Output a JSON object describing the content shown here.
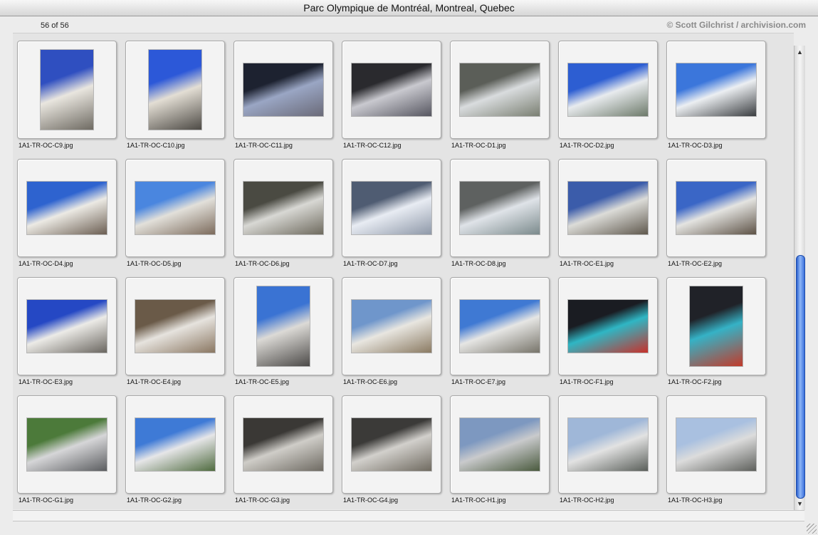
{
  "window": {
    "title": "Parc Olympique de Montréal, Montreal, Quebec",
    "counter": "56 of 56",
    "copyright": "© Scott Gilchrist / archivision.com"
  },
  "thumbnails": [
    {
      "filename": "1A1-TR-OC-C9.jpg",
      "orientation": "portrait",
      "colors": [
        "#2f4fc0",
        "#e9e6df",
        "#6e6a62"
      ]
    },
    {
      "filename": "1A1-TR-OC-C10.jpg",
      "orientation": "portrait",
      "colors": [
        "#2c58d8",
        "#e3ded4",
        "#4d4a45"
      ]
    },
    {
      "filename": "1A1-TR-OC-C11.jpg",
      "orientation": "landscape",
      "colors": [
        "#1d2230",
        "#9aa6c4",
        "#6a6a78"
      ]
    },
    {
      "filename": "1A1-TR-OC-C12.jpg",
      "orientation": "landscape",
      "colors": [
        "#2a2a2e",
        "#c9c9cf",
        "#565660"
      ]
    },
    {
      "filename": "1A1-TR-OC-D1.jpg",
      "orientation": "landscape",
      "colors": [
        "#5b5e58",
        "#d9dcde",
        "#7a7f72"
      ]
    },
    {
      "filename": "1A1-TR-OC-D2.jpg",
      "orientation": "landscape",
      "colors": [
        "#2d5ed2",
        "#e8ebee",
        "#6d7a6a"
      ]
    },
    {
      "filename": "1A1-TR-OC-D3.jpg",
      "orientation": "landscape",
      "colors": [
        "#3b76db",
        "#eceff2",
        "#3a3d40"
      ]
    },
    {
      "filename": "1A1-TR-OC-D4.jpg",
      "orientation": "landscape",
      "colors": [
        "#2e63cf",
        "#eceae4",
        "#6b5e52"
      ]
    },
    {
      "filename": "1A1-TR-OC-D5.jpg",
      "orientation": "landscape",
      "colors": [
        "#4a86df",
        "#e2e0da",
        "#7c6b5c"
      ]
    },
    {
      "filename": "1A1-TR-OC-D6.jpg",
      "orientation": "landscape",
      "colors": [
        "#4a4a42",
        "#d8d8d4",
        "#6e6a5e"
      ]
    },
    {
      "filename": "1A1-TR-OC-D7.jpg",
      "orientation": "landscape",
      "colors": [
        "#4f5c72",
        "#e8ecf3",
        "#8e98a8"
      ]
    },
    {
      "filename": "1A1-TR-OC-D8.jpg",
      "orientation": "landscape",
      "colors": [
        "#5e6160",
        "#dfe3e8",
        "#7b8a8c"
      ]
    },
    {
      "filename": "1A1-TR-OC-E1.jpg",
      "orientation": "landscape",
      "colors": [
        "#3b5caa",
        "#dcdcd8",
        "#5f584d"
      ]
    },
    {
      "filename": "1A1-TR-OC-E2.jpg",
      "orientation": "landscape",
      "colors": [
        "#3a66c6",
        "#e4e4e1",
        "#5d5246"
      ]
    },
    {
      "filename": "1A1-TR-OC-E3.jpg",
      "orientation": "landscape",
      "colors": [
        "#2548c4",
        "#ecebe7",
        "#6a6660"
      ]
    },
    {
      "filename": "1A1-TR-OC-E4.jpg",
      "orientation": "landscape",
      "colors": [
        "#6a5a48",
        "#e6e3de",
        "#8a7762"
      ]
    },
    {
      "filename": "1A1-TR-OC-E5.jpg",
      "orientation": "portrait",
      "colors": [
        "#3a73d3",
        "#dcdad6",
        "#4c4a48"
      ]
    },
    {
      "filename": "1A1-TR-OC-E6.jpg",
      "orientation": "landscape",
      "colors": [
        "#6f96cb",
        "#e8e6e0",
        "#8a7a62"
      ]
    },
    {
      "filename": "1A1-TR-OC-E7.jpg",
      "orientation": "landscape",
      "colors": [
        "#3f79d3",
        "#e6e6e4",
        "#77746a"
      ]
    },
    {
      "filename": "1A1-TR-OC-F1.jpg",
      "orientation": "landscape",
      "colors": [
        "#1a1c22",
        "#2fb6c4",
        "#c8312b"
      ]
    },
    {
      "filename": "1A1-TR-OC-F2.jpg",
      "orientation": "portrait",
      "colors": [
        "#202228",
        "#35b2c6",
        "#c23a2a"
      ]
    },
    {
      "filename": "1A1-TR-OC-G1.jpg",
      "orientation": "landscape",
      "colors": [
        "#4c7a3a",
        "#d6d6d8",
        "#5b5d60"
      ]
    },
    {
      "filename": "1A1-TR-OC-G2.jpg",
      "orientation": "landscape",
      "colors": [
        "#3e7ad6",
        "#e6e6e8",
        "#4f6b3f"
      ]
    },
    {
      "filename": "1A1-TR-OC-G3.jpg",
      "orientation": "landscape",
      "colors": [
        "#3a3835",
        "#cfcdc8",
        "#6e6a62"
      ]
    },
    {
      "filename": "1A1-TR-OC-G4.jpg",
      "orientation": "landscape",
      "colors": [
        "#3b3a38",
        "#d2d0cc",
        "#6f6a60"
      ]
    },
    {
      "filename": "1A1-TR-OC-H1.jpg",
      "orientation": "landscape",
      "colors": [
        "#7d98c0",
        "#c9cacc",
        "#4a5a3e"
      ]
    },
    {
      "filename": "1A1-TR-OC-H2.jpg",
      "orientation": "landscape",
      "colors": [
        "#9fb7d8",
        "#e2e2e2",
        "#5a5f5a"
      ]
    },
    {
      "filename": "1A1-TR-OC-H3.jpg",
      "orientation": "landscape",
      "colors": [
        "#a9c0e0",
        "#dcdcdc",
        "#5e605c"
      ]
    }
  ]
}
